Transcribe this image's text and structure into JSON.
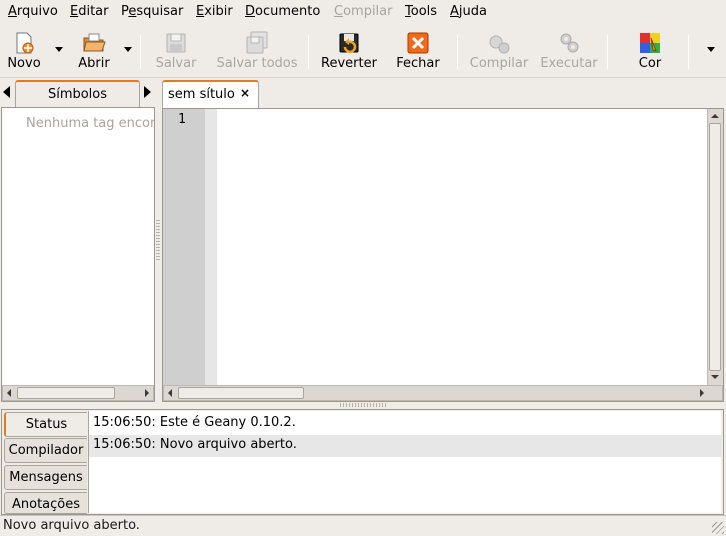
{
  "menubar": {
    "items": [
      {
        "label": "Arquivo",
        "underline_index": 0,
        "enabled": true
      },
      {
        "label": "Editar",
        "underline_index": 0,
        "enabled": true
      },
      {
        "label": "Pesquisar",
        "underline_index": 1,
        "enabled": true
      },
      {
        "label": "Exibir",
        "underline_index": 0,
        "enabled": true
      },
      {
        "label": "Documento",
        "underline_index": 0,
        "enabled": true
      },
      {
        "label": "Compilar",
        "underline_index": 0,
        "enabled": false
      },
      {
        "label": "Tools",
        "underline_index": 0,
        "enabled": true
      },
      {
        "label": "Ajuda",
        "underline_index": 0,
        "enabled": true
      }
    ]
  },
  "toolbar": {
    "novo": "Novo",
    "abrir": "Abrir",
    "salvar": "Salvar",
    "salvar_todos": "Salvar todos",
    "reverter": "Reverter",
    "fechar": "Fechar",
    "compilar": "Compilar",
    "executar": "Executar",
    "cor": "Cor"
  },
  "sidebar": {
    "tab_label": "Símbolos",
    "empty_text": "Nenhuma tag encon"
  },
  "editor": {
    "tab_label": "sem sítulo",
    "close_glyph": "×",
    "line_number": "1"
  },
  "bottom": {
    "tabs": [
      "Status",
      "Compilador",
      "Mensagens",
      "Anotações"
    ],
    "messages": [
      "15:06:50: Este é Geany 0.10.2.",
      "15:06:50: Novo arquivo aberto."
    ]
  },
  "statusbar": {
    "text": "Novo arquivo aberto."
  },
  "colors": {
    "window_bg": "#efebe7",
    "tab_accent": "#e07b2a",
    "gutter": "#cfcfcf",
    "selected_row": "#e7e7e7"
  },
  "icons": [
    "new-file-icon",
    "open-folder-icon",
    "save-icon",
    "save-all-icon",
    "revert-icon",
    "close-x-icon",
    "compile-icon",
    "execute-gears-icon",
    "color-picker-icon"
  ]
}
